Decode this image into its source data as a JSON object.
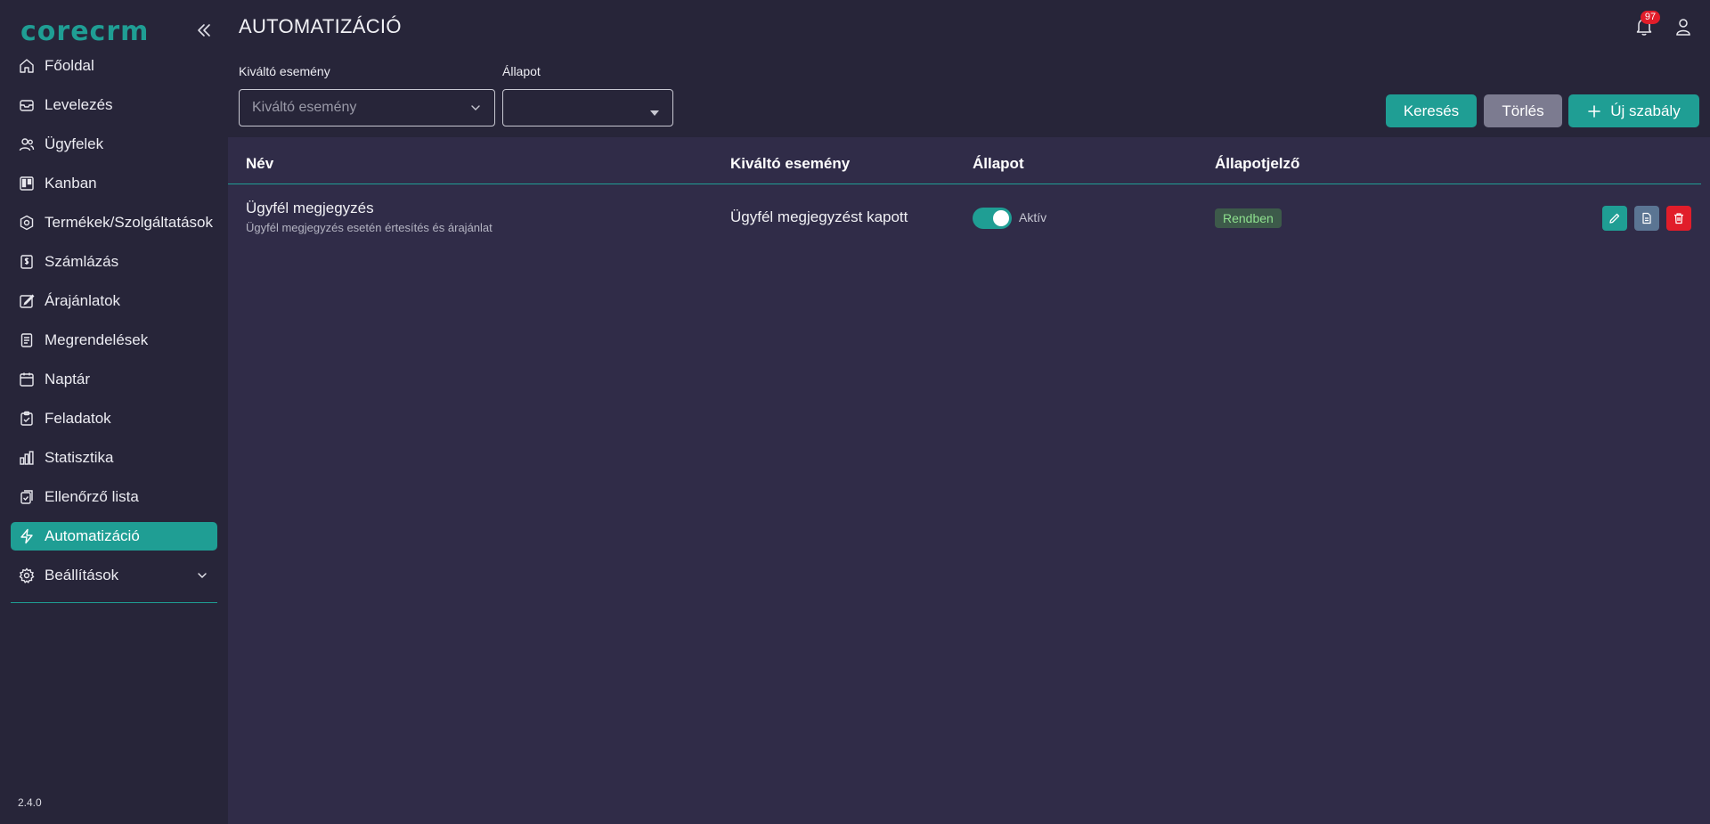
{
  "app": {
    "logo": "corecrm",
    "version": "2.4.0"
  },
  "sidebar": {
    "items": [
      {
        "label": "Főoldal",
        "icon": "home-icon"
      },
      {
        "label": "Levelezés",
        "icon": "mail-icon"
      },
      {
        "label": "Ügyfelek",
        "icon": "users-icon"
      },
      {
        "label": "Kanban",
        "icon": "kanban-icon"
      },
      {
        "label": "Termékek/Szolgáltatások",
        "icon": "product-icon"
      },
      {
        "label": "Számlázás",
        "icon": "invoice-icon"
      },
      {
        "label": "Árajánlatok",
        "icon": "quote-icon"
      },
      {
        "label": "Megrendelések",
        "icon": "order-icon"
      },
      {
        "label": "Naptár",
        "icon": "calendar-icon"
      },
      {
        "label": "Feladatok",
        "icon": "tasks-icon"
      },
      {
        "label": "Statisztika",
        "icon": "chart-icon"
      },
      {
        "label": "Ellenőrző lista",
        "icon": "checklist-icon"
      },
      {
        "label": "Automatizáció",
        "icon": "bolt-icon",
        "active": true
      },
      {
        "label": "Beállítások",
        "icon": "gear-icon"
      }
    ]
  },
  "header": {
    "title": "AUTOMATIZÁCIÓ",
    "notification_count": "97"
  },
  "filters": {
    "trigger_label": "Kiváltó esemény",
    "trigger_placeholder": "Kiváltó esemény",
    "status_label": "Állapot",
    "status_value": ""
  },
  "buttons": {
    "search": "Keresés",
    "clear": "Törlés",
    "new_rule": "Új szabály"
  },
  "table": {
    "columns": [
      "Név",
      "Kiváltó esemény",
      "Állapot",
      "Állapotjelző"
    ],
    "rows": [
      {
        "name": "Ügyfél megjegyzés",
        "description": "Ügyfél megjegyzés esetén értesítés és árajánlat",
        "trigger": "Ügyfél megjegyzést kapott",
        "status": "Aktív",
        "active": true,
        "indicator": "Rendben"
      }
    ]
  },
  "colors": {
    "accent": "#1f9e94",
    "danger": "#e11d2a",
    "background": "#272539",
    "panel": "#302c48"
  }
}
